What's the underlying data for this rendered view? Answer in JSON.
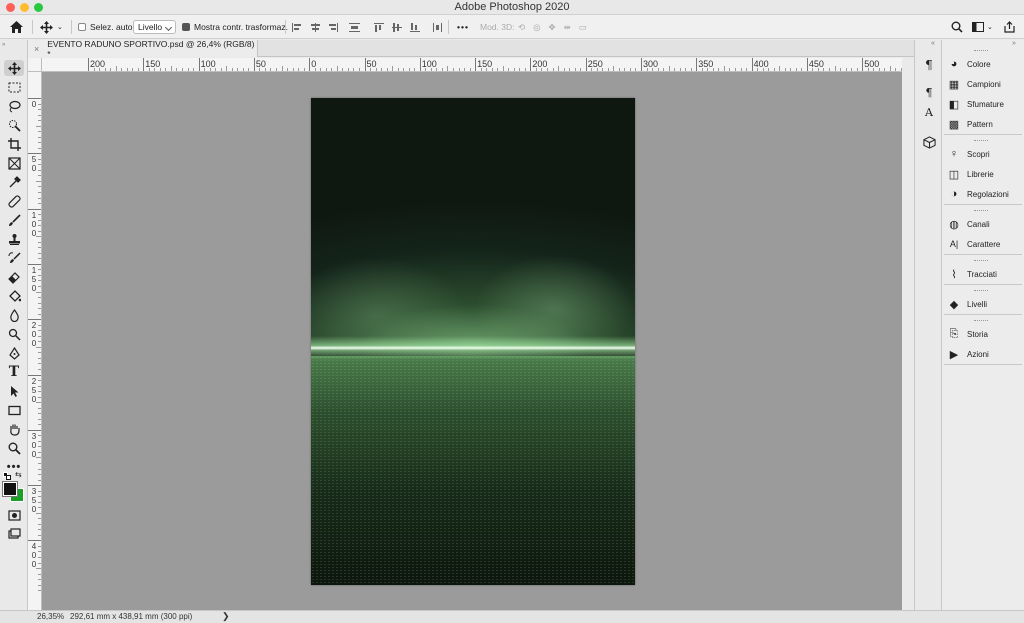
{
  "app": {
    "title": "Adobe Photoshop 2020"
  },
  "window_controls": {
    "close_color": "#fe5f57",
    "minimize_color": "#febc2e",
    "zoom_color": "#28c840"
  },
  "options_bar": {
    "auto_select_label": "Selez. auto:",
    "auto_select_checked": false,
    "auto_select_target": "Livello",
    "show_transform_label": "Mostra contr. trasformaz.",
    "show_transform_checked": true,
    "more_label": "•••",
    "mode3d_label": "Mod. 3D:"
  },
  "document_tab": {
    "title": "EVENTO RADUNO SPORTIVO.psd @ 26,4% (RGB/8) *",
    "close_label": "×"
  },
  "ruler_top": {
    "labels": [
      "200",
      "150",
      "100",
      "50",
      "0",
      "50",
      "100",
      "150",
      "200",
      "250",
      "300",
      "350",
      "400",
      "450",
      "500"
    ]
  },
  "ruler_left": {
    "labels": [
      "0",
      "5\n0",
      "1\n0\n0",
      "1\n5\n0",
      "2\n0\n0",
      "2\n5\n0",
      "3\n0\n0",
      "3\n5\n0",
      "4\n0\n0"
    ]
  },
  "colors": {
    "foreground": "#111111",
    "background": "#1aa024",
    "pasteboard": "#9b9b9b"
  },
  "right_panel": {
    "groups": [
      {
        "items": [
          {
            "label": "Colore",
            "icon": "color-palette-icon"
          },
          {
            "label": "Campioni",
            "icon": "swatches-grid-icon"
          },
          {
            "label": "Sfumature",
            "icon": "gradient-icon"
          },
          {
            "label": "Pattern",
            "icon": "pattern-icon"
          }
        ]
      },
      {
        "items": [
          {
            "label": "Scopri",
            "icon": "lightbulb-icon"
          },
          {
            "label": "Librerie",
            "icon": "library-icon"
          },
          {
            "label": "Regolazioni",
            "icon": "adjustments-icon"
          }
        ]
      },
      {
        "items": [
          {
            "label": "Canali",
            "icon": "channels-icon"
          },
          {
            "label": "Carattere",
            "icon": "character-icon"
          }
        ]
      },
      {
        "items": [
          {
            "label": "Tracciati",
            "icon": "paths-icon"
          }
        ]
      },
      {
        "items": [
          {
            "label": "Livelli",
            "icon": "layers-icon"
          }
        ]
      },
      {
        "items": [
          {
            "label": "Storia",
            "icon": "history-icon"
          },
          {
            "label": "Azioni",
            "icon": "play-icon"
          }
        ]
      }
    ]
  },
  "status_bar": {
    "zoom": "26,35%",
    "doc_info": "292,61 mm x 438,91 mm (300 ppi)",
    "chevron": "❯"
  }
}
